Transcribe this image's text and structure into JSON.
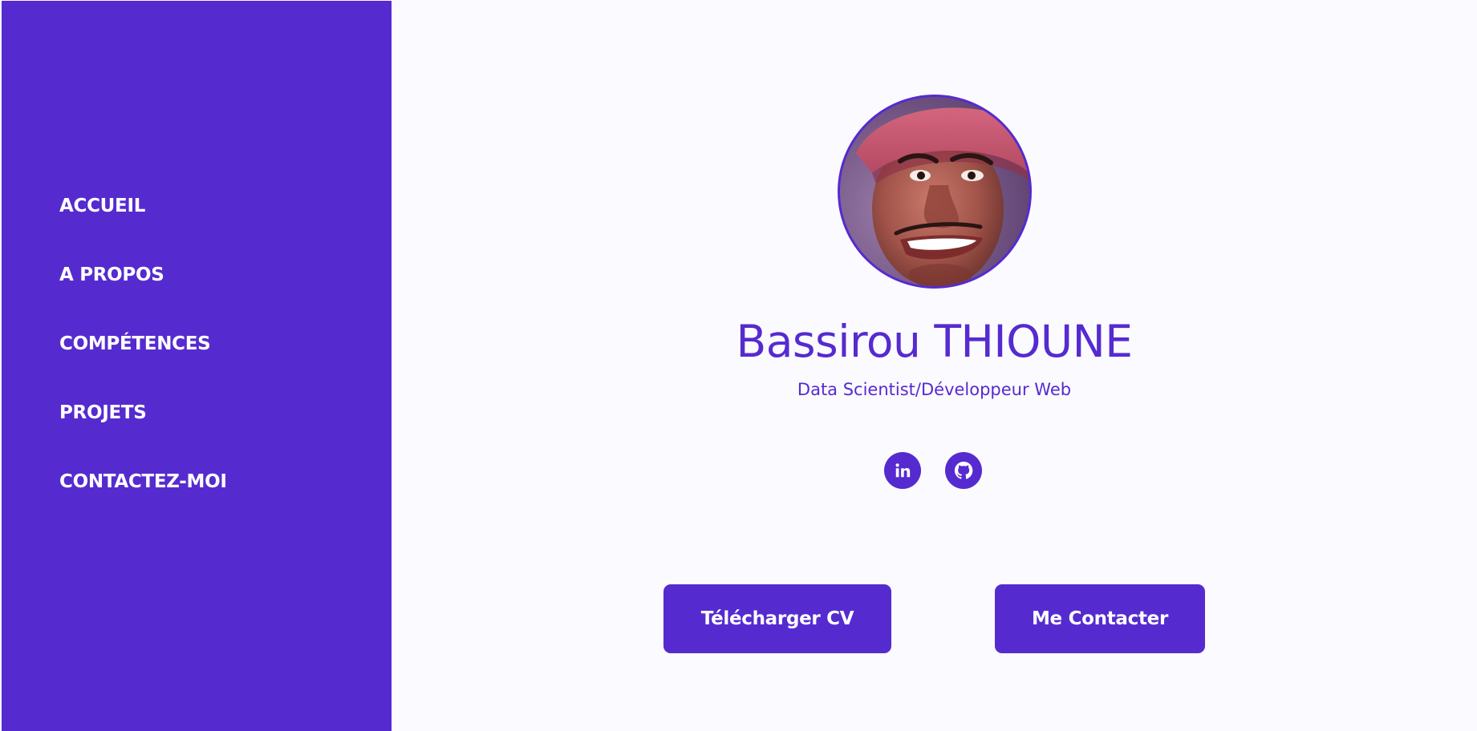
{
  "sidebar": {
    "items": [
      {
        "label": "ACCUEIL"
      },
      {
        "label": "A PROPOS"
      },
      {
        "label": "COMPÉTENCES"
      },
      {
        "label": "PROJETS"
      },
      {
        "label": "CONTACTEZ-MOI"
      }
    ]
  },
  "profile": {
    "name": "Bassirou THIOUNE",
    "subtitle": "Data Scientist/Développeur Web"
  },
  "socials": [
    {
      "icon": "linkedin-icon"
    },
    {
      "icon": "github-icon"
    }
  ],
  "actions": {
    "download_cv_label": "Télécharger CV",
    "contact_label": "Me Contacter"
  },
  "colors": {
    "accent": "#552bcf",
    "background": "#fbfaff",
    "text_on_accent": "#ffffff"
  }
}
